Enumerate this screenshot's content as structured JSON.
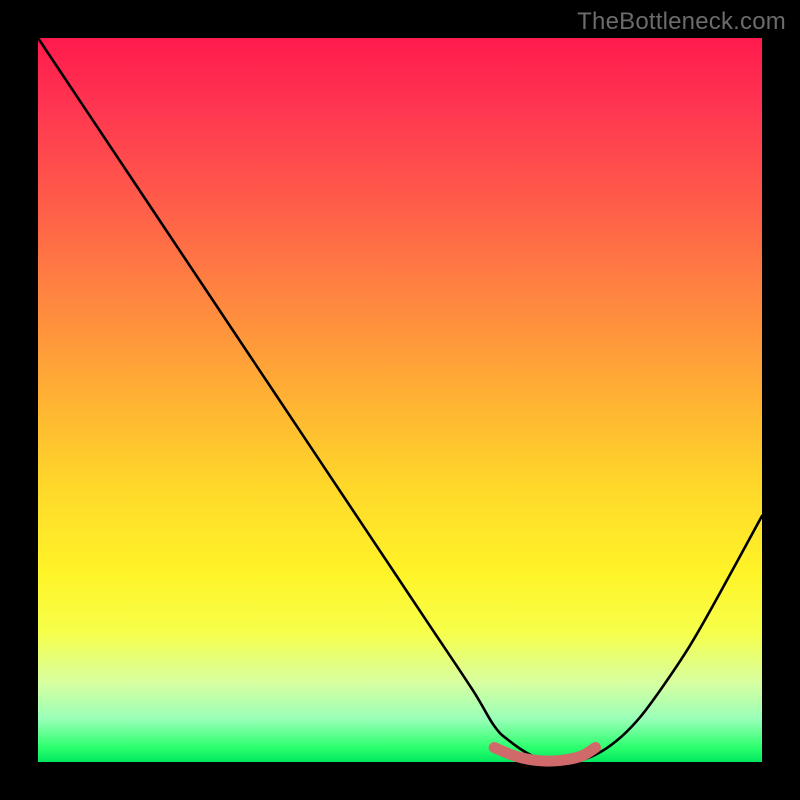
{
  "watermark": "TheBottleneck.com",
  "chart_data": {
    "type": "line",
    "title": "",
    "xlabel": "",
    "ylabel": "",
    "xlim": [
      0,
      100
    ],
    "ylim": [
      0,
      100
    ],
    "background_gradient": {
      "top": "#ff1a4d",
      "bottom": "#00e85e",
      "meaning": "red=high bottleneck, green=low bottleneck"
    },
    "series": [
      {
        "name": "bottleneck-curve",
        "color": "#000000",
        "x": [
          0,
          6,
          12,
          18,
          24,
          30,
          36,
          42,
          48,
          54,
          60,
          63,
          65,
          68,
          71,
          74,
          77,
          80,
          83,
          86,
          90,
          94,
          100
        ],
        "values": [
          100,
          91,
          82,
          73,
          64,
          55,
          46,
          37,
          28,
          19,
          10,
          5,
          3,
          1,
          0,
          0,
          1,
          3,
          6,
          10,
          16,
          23,
          34
        ]
      },
      {
        "name": "optimal-range-marker",
        "color": "#d06a6a",
        "x": [
          63,
          66,
          69,
          72,
          75,
          77
        ],
        "values": [
          2,
          0.8,
          0.2,
          0.2,
          0.8,
          2
        ]
      }
    ],
    "annotations": []
  }
}
